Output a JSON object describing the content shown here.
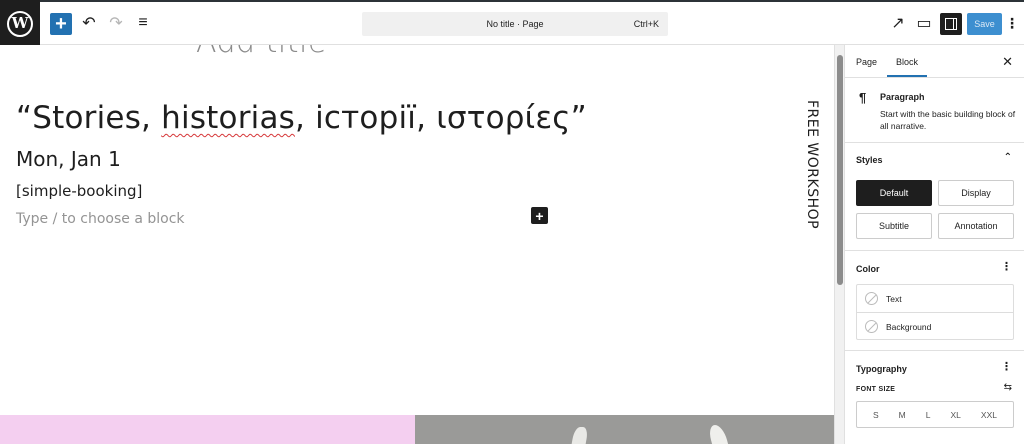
{
  "topbar": {
    "logo_text": "W",
    "inserter_label": "+",
    "undo_icon": "↶",
    "redo_icon": "↷",
    "list_view_icon": "≡",
    "document_title": "No title · Page",
    "command_shortcut": "Ctrl+K",
    "view_icon": "↗",
    "device_icon": "▭",
    "save_label": "Save",
    "more_icon": "⋮"
  },
  "canvas": {
    "title_placeholder": "Add title",
    "heading_open": "“Stories, ",
    "heading_misspelled": "historias",
    "heading_rest": ", історії, ιστορίες”",
    "date_text": "Mon, Jan 1",
    "shortcode_text": "[simple-booking]",
    "block_placeholder": "Type / to choose a block",
    "block_plus_icon": "+",
    "vertical_text": "FREE WORKSHOP"
  },
  "sidebar": {
    "tabs": [
      {
        "label": "Page"
      },
      {
        "label": "Block"
      }
    ],
    "active_tab": "Block",
    "close_icon": "✕",
    "block_card": {
      "icon": "¶",
      "name": "Paragraph",
      "description": "Start with the basic building block of all narrative."
    },
    "styles": {
      "heading": "Styles",
      "toggle_icon": "⌃",
      "options": [
        "Default",
        "Display",
        "Subtitle",
        "Annotation"
      ],
      "selected": "Default"
    },
    "color": {
      "heading": "Color",
      "menu_icon": "⋮",
      "items": [
        "Text",
        "Background"
      ]
    },
    "typography": {
      "heading": "Typography",
      "menu_icon": "⋮",
      "font_size_label": "FONT SIZE",
      "font_size_options_icon": "⇆",
      "sizes": [
        "S",
        "M",
        "L",
        "XL",
        "XXL"
      ]
    }
  },
  "colors": {
    "accent": "#2271b1",
    "save_bg": "#3d8fd0",
    "dark": "#1e1e1e",
    "pink_panel": "#f4cff0"
  }
}
